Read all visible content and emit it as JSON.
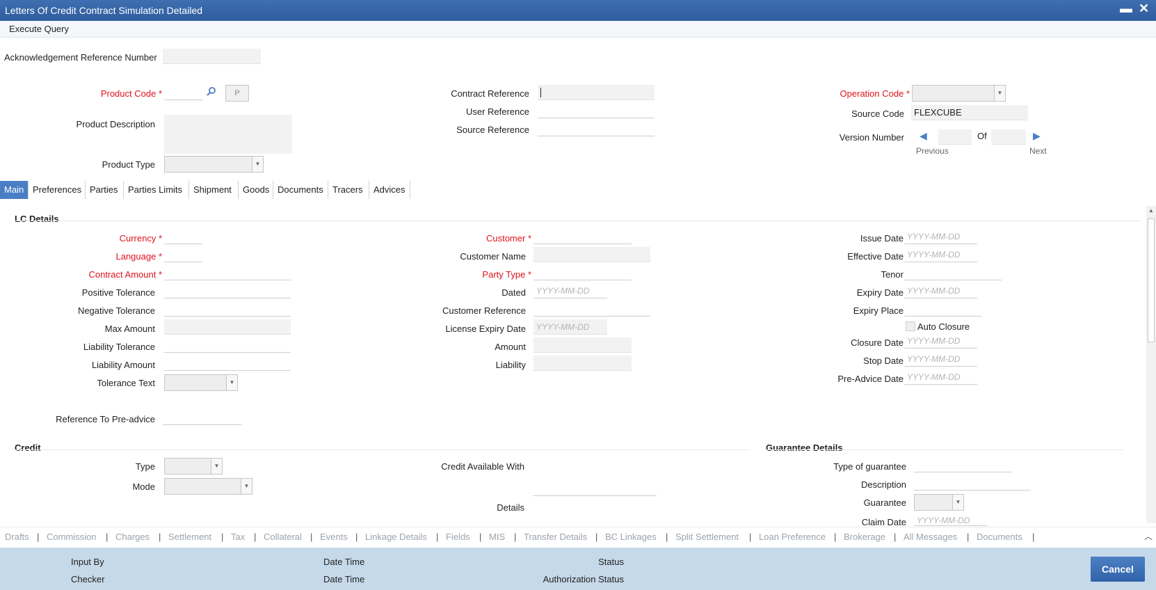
{
  "window": {
    "title": "Letters Of Credit Contract Simulation Detailed",
    "minimize": "▬",
    "close": "✕"
  },
  "menu": {
    "execute_query": "Execute Query"
  },
  "header": {
    "ack_ref_label": "Acknowledgement Reference Number",
    "product_code_label": "Product Code",
    "product_code_button": "P",
    "product_description_label": "Product Description",
    "product_type_label": "Product Type",
    "contract_reference_label": "Contract Reference",
    "user_reference_label": "User Reference",
    "source_reference_label": "Source Reference",
    "operation_code_label": "Operation Code",
    "source_code_label": "Source Code",
    "source_code_value": "FLEXCUBE",
    "version_number_label": "Version Number",
    "version_of": "Of",
    "previous": "Previous",
    "next": "Next"
  },
  "tabs": [
    "Main",
    "Preferences",
    "Parties",
    "Parties Limits",
    "Shipment",
    "Goods",
    "Documents",
    "Tracers",
    "Advices"
  ],
  "lc_details": {
    "title": "LC Details",
    "currency": "Currency",
    "language": "Language",
    "contract_amount": "Contract Amount",
    "positive_tolerance": "Positive Tolerance",
    "negative_tolerance": "Negative Tolerance",
    "max_amount": "Max Amount",
    "liability_tolerance": "Liability Tolerance",
    "liability_amount": "Liability Amount",
    "tolerance_text": "Tolerance Text",
    "reference_to_preadvice": "Reference To Pre-advice",
    "customer": "Customer",
    "customer_name": "Customer Name",
    "party_type": "Party Type",
    "dated": "Dated",
    "customer_reference": "Customer Reference",
    "license_expiry_date": "License Expiry Date",
    "amount": "Amount",
    "liability": "Liability",
    "issue_date": "Issue Date",
    "effective_date": "Effective Date",
    "tenor": "Tenor",
    "expiry_date": "Expiry Date",
    "expiry_place": "Expiry Place",
    "auto_closure": "Auto Closure",
    "closure_date": "Closure Date",
    "stop_date": "Stop Date",
    "pre_advice_date": "Pre-Advice Date",
    "date_placeholder": "YYYY-MM-DD"
  },
  "credit": {
    "title": "Credit",
    "type": "Type",
    "mode": "Mode",
    "credit_available_with": "Credit Available With",
    "details": "Details"
  },
  "guarantee": {
    "title": "Guarantee Details",
    "type_of_guarantee": "Type of guarantee",
    "description": "Description",
    "guarantee": "Guarantee",
    "claim_date": "Claim Date"
  },
  "subscreens": [
    "Drafts",
    "Commission",
    "Charges",
    "Settlement",
    "Tax",
    "Collateral",
    "Events",
    "Linkage Details",
    "Fields",
    "MIS",
    "Transfer Details",
    "BC Linkages",
    "Split Settlement",
    "Loan Preference",
    "Brokerage",
    "All Messages",
    "Documents"
  ],
  "footer": {
    "input_by": "Input By",
    "checker": "Checker",
    "date_time_1": "Date Time",
    "date_time_2": "Date Time",
    "status": "Status",
    "authorization_status": "Authorization Status",
    "cancel": "Cancel"
  }
}
